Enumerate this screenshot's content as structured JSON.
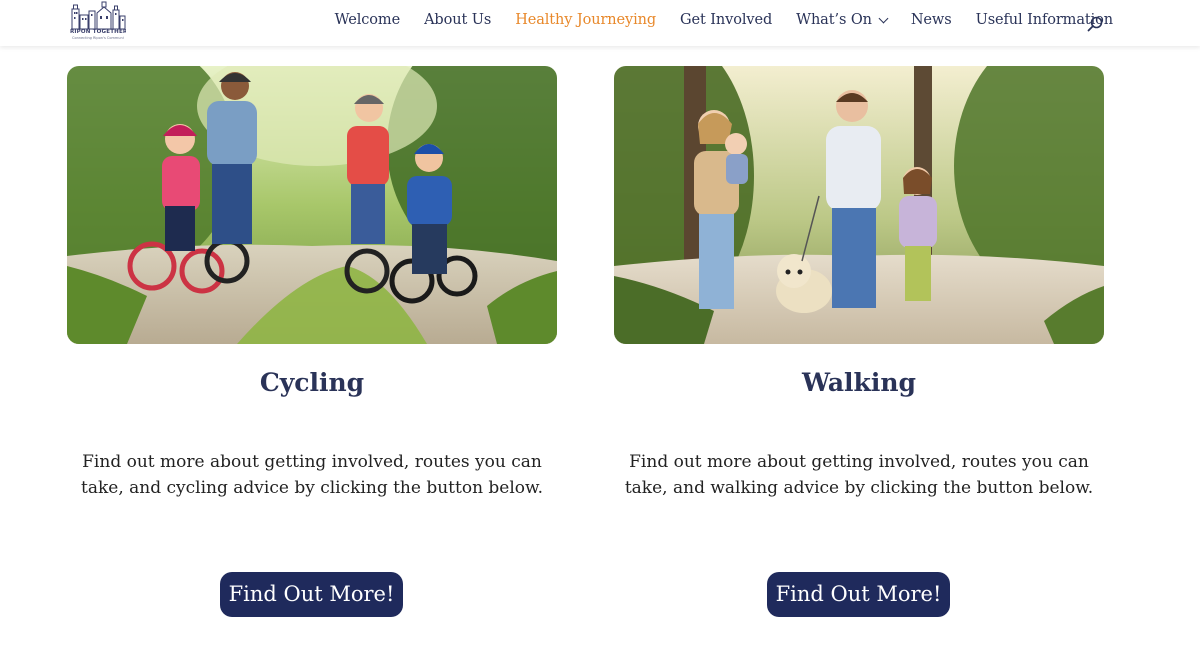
{
  "logo": {
    "name": "RIPON TOGETHER",
    "tagline": "Connecting Ripon's Community"
  },
  "nav": {
    "items": [
      {
        "label": "Welcome"
      },
      {
        "label": "About Us"
      },
      {
        "label": "Healthy Journeying",
        "active": true
      },
      {
        "label": "Get Involved"
      },
      {
        "label": "What’s On",
        "has_dropdown": true
      },
      {
        "label": "News"
      },
      {
        "label": "Useful Information"
      }
    ],
    "search_icon": "search-icon"
  },
  "cards": [
    {
      "title": "Cycling",
      "body": "Find out more about getting involved, routes you can take, and cycling advice by clicking the button below.",
      "button": "Find Out More!"
    },
    {
      "title": "Walking",
      "body": "Find out more about getting involved, routes you can take, and walking advice by clicking the button below.",
      "button": "Find Out More!"
    }
  ],
  "colors": {
    "nav_text": "#2a3358",
    "nav_active": "#e8882a",
    "button_bg": "#1f2a5c",
    "title": "#2a3358"
  }
}
